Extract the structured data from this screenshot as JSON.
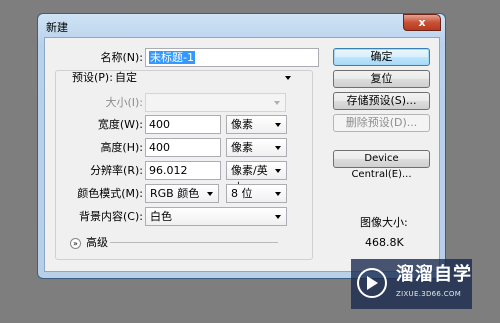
{
  "window": {
    "title": "新建",
    "close_glyph": "x"
  },
  "form": {
    "name": {
      "label": "名称(N):",
      "value": "未标题-1"
    },
    "preset": {
      "label": "预设(P):",
      "value": "自定"
    },
    "size": {
      "label": "大小(I):",
      "value": ""
    },
    "width": {
      "label": "宽度(W):",
      "value": "400",
      "unit": "像素"
    },
    "height": {
      "label": "高度(H):",
      "value": "400",
      "unit": "像素"
    },
    "resolution": {
      "label": "分辨率(R):",
      "value": "96.012",
      "unit": "像素/英寸"
    },
    "color_mode": {
      "label": "颜色模式(M):",
      "value": "RGB 颜色",
      "depth": "8 位"
    },
    "background": {
      "label": "背景内容(C):",
      "value": "白色"
    },
    "advanced": {
      "label": "高级",
      "icon": "chevron-double-down-icon",
      "glyph": "»"
    }
  },
  "buttons": {
    "ok": "确定",
    "reset": "复位",
    "save_preset": "存储预设(S)...",
    "delete_preset": "删除预设(D)...",
    "device_central": "Device Central(E)..."
  },
  "image_size": {
    "label": "图像大小:",
    "value": "468.8K"
  },
  "watermark": {
    "name": "溜溜自学",
    "url": "ZIXUE.3D66.COM"
  },
  "colors": {
    "selection": "#3399ff",
    "default_button": "#3c7fb1",
    "watermark_bg": "#16284e"
  }
}
